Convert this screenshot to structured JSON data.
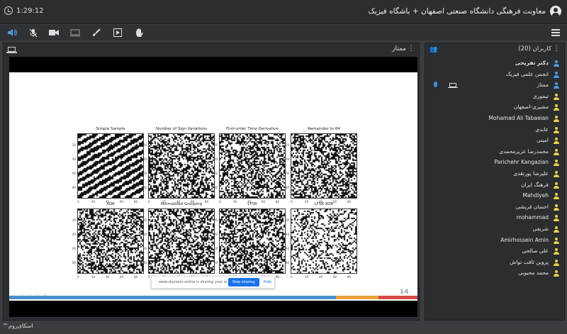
{
  "topbar": {
    "clock_time": "1:29:12",
    "room_title": "معاونت فرهنگی دانشگاه صنعتی اصفهان + باشگاه فیزیک"
  },
  "toolbar": {
    "icons": [
      "speaker-icon",
      "mic-off-icon",
      "camera-icon",
      "screen-icon",
      "brush-icon",
      "play-icon",
      "hand-icon"
    ]
  },
  "content": {
    "panel_title": "ممتاز",
    "slide": {
      "plots": [
        {
          "title": "Simple Sample"
        },
        {
          "title": "Number of Sign Variations"
        },
        {
          "title": "First-order Time Derivative"
        },
        {
          "title": "Remainder to 64"
        },
        {
          "title": "XOR"
        },
        {
          "title": "Normalized Grouping"
        },
        {
          "title": "LFSR"
        },
        {
          "title": "LFSR XOR"
        }
      ],
      "y_ticks": [
        "20",
        "40",
        "60",
        "80"
      ],
      "x_ticks": [
        "0",
        "20",
        "40",
        "60",
        "80"
      ],
      "page_number": "14"
    },
    "share_bar": {
      "text": "www.skyroom.online is sharing your screen.",
      "stop_label": "Stop sharing",
      "hide_label": "Hide"
    }
  },
  "users": {
    "title": "کاربران (20)",
    "list": [
      {
        "name": "دکتر تفریحی",
        "bold": true,
        "color": "#4a9be8"
      },
      {
        "name": "انجمن علمی فیزیک",
        "bold": false,
        "color": "#4a9be8"
      },
      {
        "name": "ممتاز",
        "bold": false,
        "color": "#4a9be8",
        "sharing": true
      },
      {
        "name": "تیموری",
        "bold": false,
        "color": "#e8d24a"
      },
      {
        "name": "مشیری-اصفهان",
        "bold": false,
        "color": "#e8d24a"
      },
      {
        "name": "Mohamad Ali Tabaeian",
        "bold": false,
        "color": "#e8d24a"
      },
      {
        "name": "عابدی",
        "bold": false,
        "color": "#e8d24a"
      },
      {
        "name": "امینی",
        "bold": false,
        "color": "#e8d24a"
      },
      {
        "name": "محمدرضا عزیزمحمدی",
        "bold": false,
        "color": "#e8d24a"
      },
      {
        "name": "Parichehr Kangazian",
        "bold": false,
        "color": "#e8d24a"
      },
      {
        "name": "علیرضا پورتقدی",
        "bold": false,
        "color": "#e8d24a"
      },
      {
        "name": "فرهنگ ایران",
        "bold": false,
        "color": "#e8d24a"
      },
      {
        "name": "Mahdiyeh",
        "bold": false,
        "color": "#e8d24a"
      },
      {
        "name": "احسان قریشی",
        "bold": false,
        "color": "#e8d24a"
      },
      {
        "name": "mohammad",
        "bold": false,
        "color": "#e8d24a"
      },
      {
        "name": "شریفی",
        "bold": false,
        "color": "#e8d24a"
      },
      {
        "name": "Amirhossein Amin",
        "bold": false,
        "color": "#e8d24a"
      },
      {
        "name": "علی صالحی",
        "bold": false,
        "color": "#e8d24a"
      },
      {
        "name": "پروین ثاقب تواش",
        "bold": false,
        "color": "#e8d24a"
      },
      {
        "name": "محمد محبوبی",
        "bold": false,
        "color": "#e8d24a"
      }
    ]
  },
  "footer": {
    "brand": "اسکای‌روم™"
  },
  "colors": {
    "accent": "#1a73e8",
    "progress_blue": "#4a8fcb",
    "progress_orange": "#e8a23a",
    "progress_red": "#d84a4a"
  }
}
